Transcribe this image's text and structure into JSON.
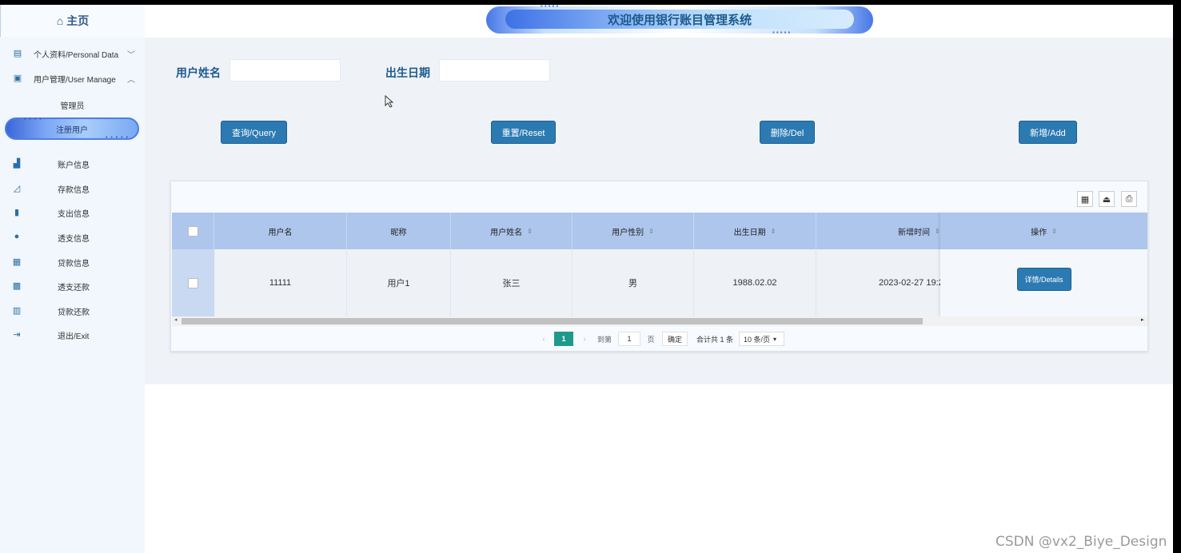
{
  "sidebar": {
    "home": "主页",
    "personal": "个人资料/Personal Data",
    "user_manage": "用户管理/User Manage",
    "admin": "管理员",
    "registered_user": "注册用户",
    "items": [
      "账户信息",
      "存款信息",
      "支出信息",
      "透支信息",
      "贷款信息",
      "透支还款",
      "贷款还款",
      "退出/Exit"
    ]
  },
  "header": {
    "title": "欢迎使用银行账目管理系统"
  },
  "search": {
    "name_label": "用户姓名",
    "name_value": "",
    "birth_label": "出生日期",
    "birth_value": ""
  },
  "buttons": {
    "query": "查询/Query",
    "reset": "重置/Reset",
    "del": "删除/Del",
    "add": "新增/Add"
  },
  "table": {
    "columns": [
      "用户名",
      "昵称",
      "用户姓名",
      "用户性别",
      "出生日期",
      "新增时间",
      "操作"
    ],
    "rows": [
      {
        "username": "11111",
        "nickname": "用户1",
        "realname": "张三",
        "gender": "男",
        "birth": "1988.02.02",
        "created": "2023-02-27 19:2",
        "action": "详情/Details"
      }
    ]
  },
  "pager": {
    "current": "1",
    "goto_label": "到第",
    "goto_value": "1",
    "page_unit": "页",
    "confirm": "确定",
    "total": "合计共 1 条",
    "per_page": "10 条/页"
  },
  "watermark": "CSDN @vx2_Biye_Design"
}
